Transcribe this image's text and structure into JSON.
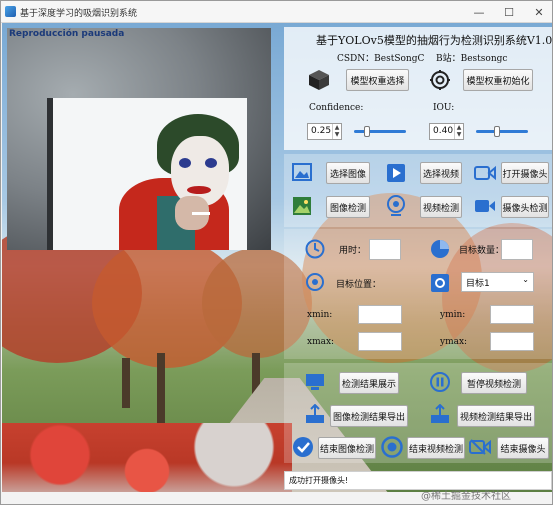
{
  "window": {
    "title": "基于深度学习的吸烟识别系统",
    "controls": [
      "minimize",
      "maximize",
      "close"
    ]
  },
  "video": {
    "overlay_tag": "Reproducción pausada"
  },
  "header": {
    "title": "基于YOLOv5模型的抽烟行为检测识别系统V1.0",
    "csdn": "CSDN：BestSongC",
    "bili": "B站：Bestsongc"
  },
  "model": {
    "select_label": "模型权重选择",
    "init_label": "模型权重初始化"
  },
  "params": {
    "confidence_label": "Confidence:",
    "confidence_value": "0.25",
    "confidence_fraction": 0.25,
    "iou_label": "IOU:",
    "iou_value": "0.40",
    "iou_fraction": 0.4
  },
  "source_buttons": {
    "select_image": "选择图像",
    "select_video": "选择视频",
    "open_camera": "打开摄像头",
    "image_detect": "图像检测",
    "video_detect": "视频检测",
    "camera_detect": "摄像头检测"
  },
  "results": {
    "time_label": "用时：",
    "time_value": "",
    "count_label": "目标数量：",
    "count_value": "",
    "position_label": "目标位置：",
    "target_select": "目标1",
    "xmin_label": "xmin:",
    "xmin_value": "",
    "ymin_label": "ymin:",
    "ymin_value": "",
    "xmax_label": "xmax:",
    "xmax_value": "",
    "ymax_label": "ymax:",
    "ymax_value": ""
  },
  "actions": {
    "show_result": "检测结果展示",
    "pause_video": "暂停视频检测",
    "export_image": "图像检测结果导出",
    "export_video": "视频检测结果导出",
    "end_image": "结束图像检测",
    "end_video": "结束视频检测",
    "end_camera": "结束摄像头"
  },
  "status": {
    "message": "成功打开摄像头!"
  },
  "watermark": "@稀土掘金技术社区",
  "colors": {
    "accent": "#2f7bd6",
    "icon_blue": "#2a6fcf"
  }
}
